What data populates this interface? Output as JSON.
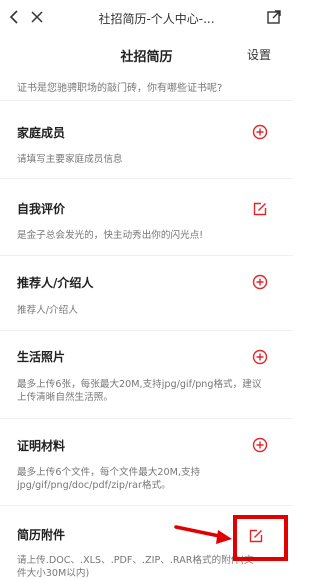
{
  "topbar": {
    "title": "社招简历-个人中心-..."
  },
  "navbar": {
    "title": "社招简历",
    "settings": "设置"
  },
  "partial_text": "证书是您驰骋职场的敲门砖，你有哪些证书呢?",
  "sections": [
    {
      "title": "家庭成员",
      "desc": "请填写主要家庭成员信息",
      "icon": "plus-circle-icon"
    },
    {
      "title": "自我评价",
      "desc": "是金子总会发光的，快主动秀出你的闪光点!",
      "icon": "edit-icon"
    },
    {
      "title": "推荐人/介绍人",
      "desc": "推荐人/介绍人",
      "icon": "plus-circle-icon"
    },
    {
      "title": "生活照片",
      "desc": "最多上传6张，每张最大20M,支持jpg/gif/png格式，建议上传清晰自然生活照。",
      "icon": "plus-circle-icon"
    },
    {
      "title": "证明材料",
      "desc": "最多上传6个文件，每个文件最大20M,支持jpg/gif/png/doc/pdf/zip/rar格式。",
      "icon": "plus-circle-icon"
    },
    {
      "title": "简历附件",
      "desc": "请上传.DOC、.XLS、.PDF、.ZIP、.RAR格式的附件(文件大小30M以内)",
      "icon": "edit-icon"
    }
  ],
  "colors": {
    "accent": "#e0262b",
    "highlight": "#e10000"
  }
}
